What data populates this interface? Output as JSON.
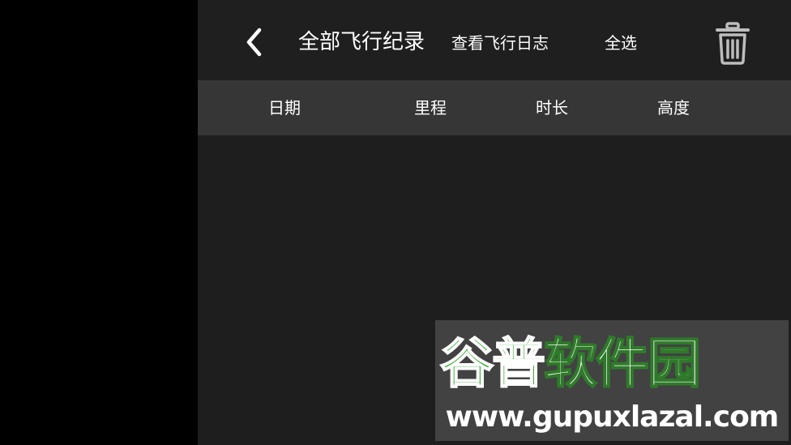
{
  "header": {
    "title": "全部飞行纪录",
    "view_log_label": "查看飞行日志",
    "select_all_label": "全选",
    "back_icon": "chevron-left-icon",
    "delete_icon": "trash-icon"
  },
  "table": {
    "columns": [
      "日期",
      "里程",
      "时长",
      "高度"
    ],
    "rows": []
  },
  "watermark": {
    "logo_part1": "谷普",
    "logo_part2": "软件园",
    "url": "www.gupuxlazal.com"
  },
  "colors": {
    "panel_bg": "#1e1e1e",
    "header_row_bg": "#363636",
    "text": "#ffffff",
    "icon_gray": "#bdbdbd"
  }
}
